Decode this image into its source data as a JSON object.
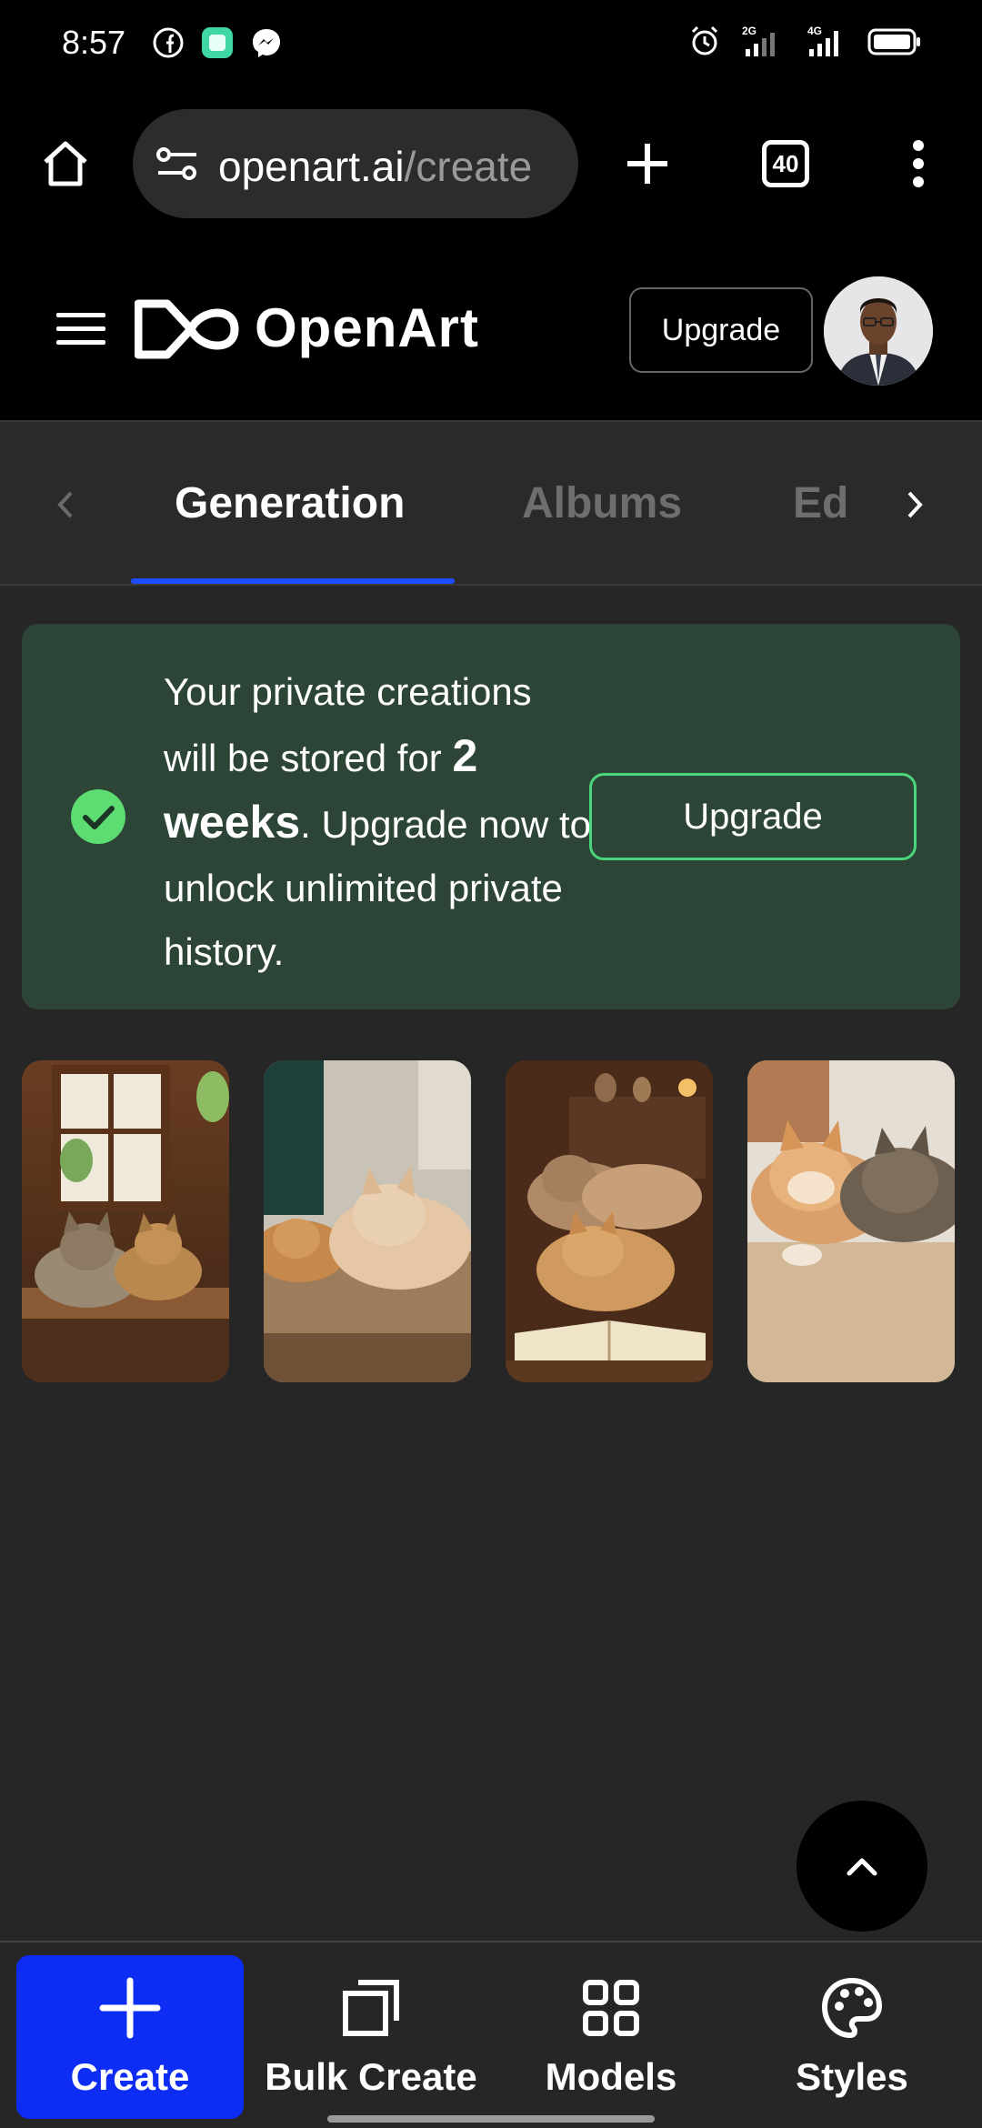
{
  "status_bar": {
    "time": "8:57",
    "left_icons": [
      "facebook-icon",
      "app-icon",
      "messenger-icon"
    ],
    "right_icons": [
      "alarm-icon",
      "2g-signal-icon",
      "4g-signal-icon",
      "battery-icon"
    ],
    "net_2g": "2G",
    "net_4g": "4G"
  },
  "browser": {
    "url_domain": "openart.ai",
    "url_path": "/create",
    "tabs_count": "40"
  },
  "header": {
    "brand": "OpenArt",
    "upgrade_label": "Upgrade"
  },
  "tabs": [
    {
      "label": "Generation",
      "active": true
    },
    {
      "label": "Albums",
      "active": false
    },
    {
      "label": "Ed",
      "active": false
    }
  ],
  "notice": {
    "text_before": "Your private creations will be stored for ",
    "emphasis": "2 weeks",
    "text_after": ". Upgrade now to unlock unlimited private history.",
    "button_label": "Upgrade",
    "accent": "#4ad57a",
    "background": "#2c4536"
  },
  "gallery": {
    "images": [
      {
        "name": "cats-by-window"
      },
      {
        "name": "cats-sleeping-table"
      },
      {
        "name": "cats-with-book"
      },
      {
        "name": "cats-cuddling"
      }
    ]
  },
  "bottom_nav": [
    {
      "label": "Create",
      "icon": "plus-icon",
      "active": true
    },
    {
      "label": "Bulk Create",
      "icon": "stacked-squares-icon",
      "active": false
    },
    {
      "label": "Models",
      "icon": "grid-icon",
      "active": false
    },
    {
      "label": "Styles",
      "icon": "palette-icon",
      "active": false
    }
  ],
  "colors": {
    "primary": "#0d2df5",
    "tab_underline": "#1e4cff"
  }
}
